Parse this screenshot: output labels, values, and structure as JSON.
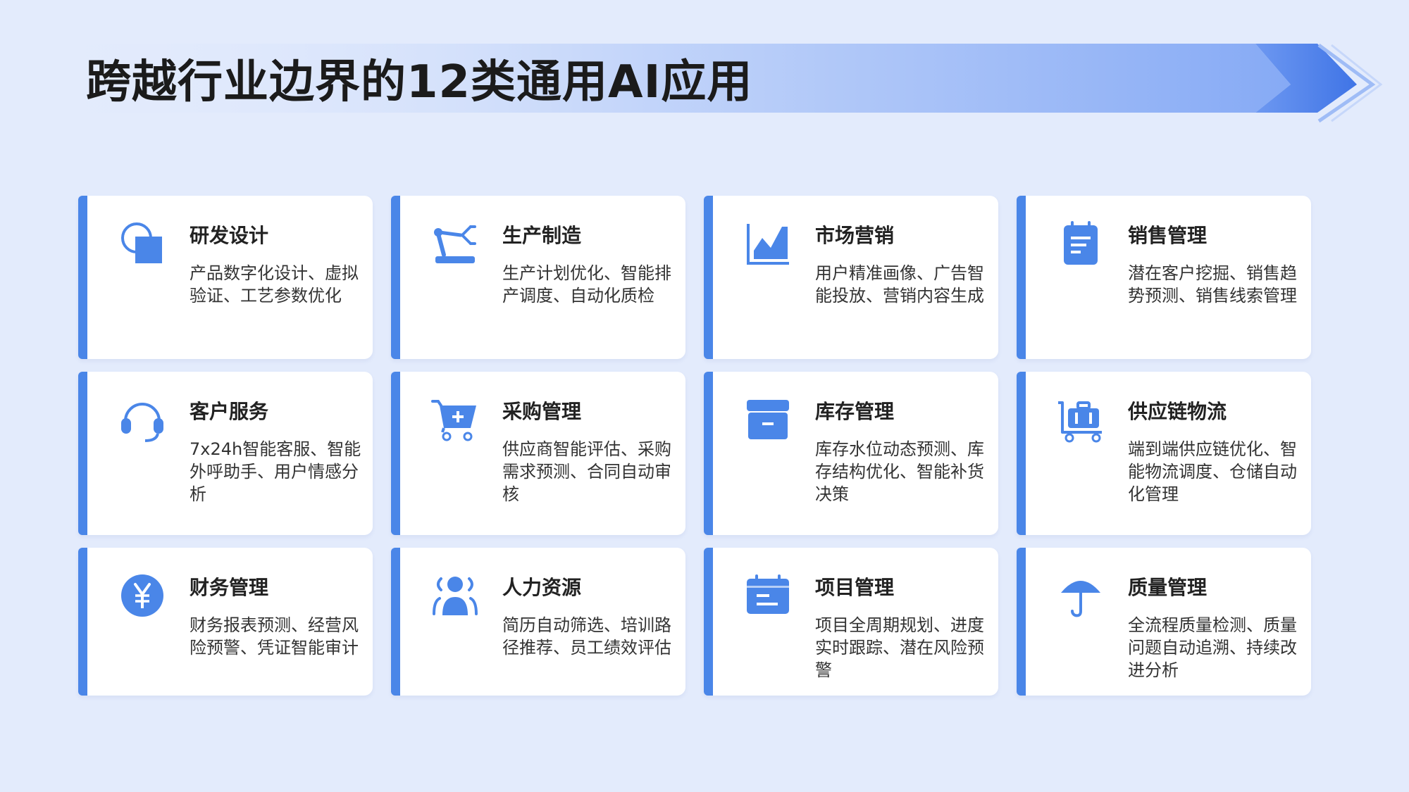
{
  "page": {
    "title": "跨越行业边界的12类通用AI应用"
  },
  "colors": {
    "background": "#e3ebfc",
    "accent": "#4a86e8",
    "card": "#ffffff",
    "title_text": "#1b1b1b"
  },
  "cards": [
    {
      "title": "研发设计",
      "desc": "产品数字化设计、虚拟验证、工艺参数优化",
      "icon": "rnd-design-icon"
    },
    {
      "title": "生产制造",
      "desc": "生产计划优化、智能排产调度、自动化质检",
      "icon": "robot-arm-icon"
    },
    {
      "title": "市场营销",
      "desc": "用户精准画像、广告智能投放、营销内容生成",
      "icon": "area-chart-icon"
    },
    {
      "title": "销售管理",
      "desc": "潜在客户挖掘、销售趋势预测、销售线索管理",
      "icon": "clipboard-icon"
    },
    {
      "title": "客户服务",
      "desc": "7x24h智能客服、智能外呼助手、用户情感分析",
      "icon": "headset-icon"
    },
    {
      "title": "采购管理",
      "desc": "供应商智能评估、采购需求预测、合同自动审核",
      "icon": "shopping-cart-icon"
    },
    {
      "title": "库存管理",
      "desc": "库存水位动态预测、库存结构优化、智能补货决策",
      "icon": "inventory-box-icon"
    },
    {
      "title": "供应链物流",
      "desc": "端到端供应链优化、智能物流调度、仓储自动化管理",
      "icon": "luggage-cart-icon"
    },
    {
      "title": "财务管理",
      "desc": "财务报表预测、经营风险预警、凭证智能审计",
      "icon": "yen-coin-icon"
    },
    {
      "title": "人力资源",
      "desc": "简历自动筛选、培训路径推荐、员工绩效评估",
      "icon": "user-group-icon"
    },
    {
      "title": "项目管理",
      "desc": "项目全周期规划、进度实时跟踪、潜在风险预警",
      "icon": "calendar-icon"
    },
    {
      "title": "质量管理",
      "desc": "全流程质量检测、质量问题自动追溯、持续改进分析",
      "icon": "umbrella-icon"
    }
  ]
}
